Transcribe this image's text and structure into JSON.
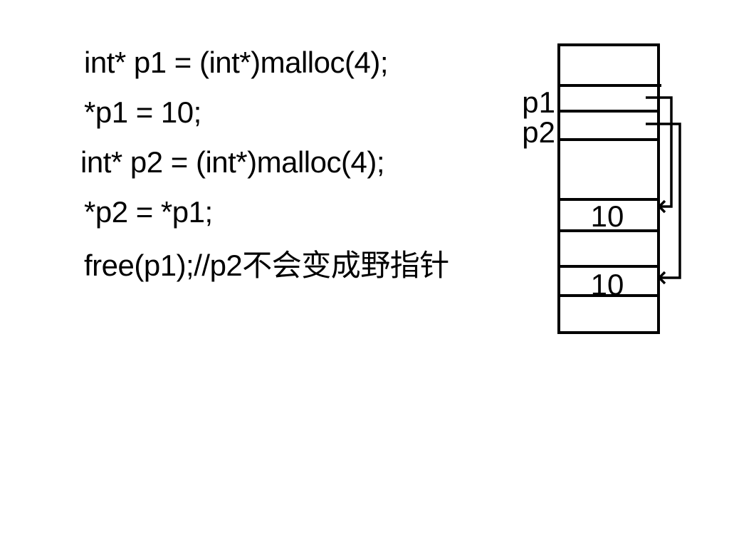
{
  "code": {
    "lines": [
      "int* p1 = (int*)malloc(4);",
      "*p1 = 10;",
      "int* p2 = (int*)malloc(4);",
      "*p2 = *p1;",
      "free(p1);//p2不会变成野指针"
    ]
  },
  "memory": {
    "pointer_labels": [
      "p1",
      "p2"
    ],
    "cell_values": [
      "10",
      "10"
    ]
  }
}
